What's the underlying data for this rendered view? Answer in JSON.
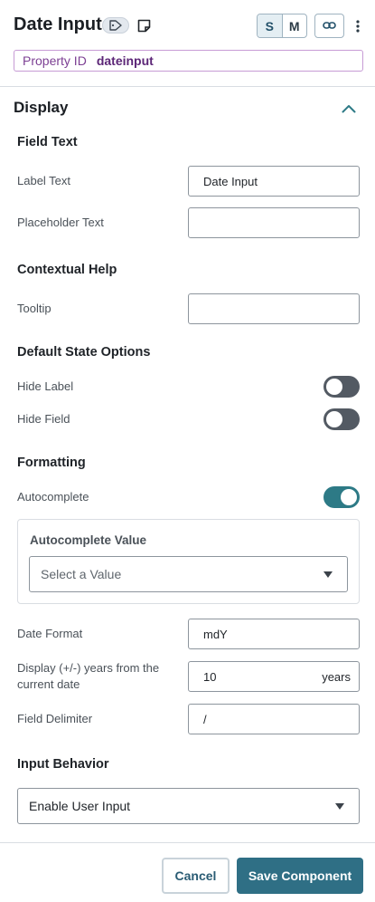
{
  "header": {
    "title": "Date Input",
    "tag_icon": "tag-icon",
    "note_icon": "sticky-note-icon",
    "size_buttons": [
      "S",
      "M"
    ],
    "active_size": "S",
    "link_icon": "link-icon",
    "menu_icon": "kebab-menu-icon",
    "property_id_label": "Property ID",
    "property_id_value": "dateinput"
  },
  "display": {
    "title": "Display",
    "collapse_icon": "chevron-up-icon",
    "field_text": {
      "title": "Field Text",
      "label_text_label": "Label Text",
      "label_text_value": "Date Input",
      "placeholder_text_label": "Placeholder Text",
      "placeholder_text_value": ""
    },
    "contextual_help": {
      "title": "Contextual Help",
      "tooltip_label": "Tooltip",
      "tooltip_value": ""
    },
    "default_state": {
      "title": "Default State Options",
      "hide_label_label": "Hide Label",
      "hide_label_on": false,
      "hide_field_label": "Hide Field",
      "hide_field_on": false
    },
    "formatting": {
      "title": "Formatting",
      "autocomplete_label": "Autocomplete",
      "autocomplete_on": true,
      "autocomplete_value_title": "Autocomplete Value",
      "autocomplete_value_placeholder": "Select a Value",
      "date_format_label": "Date Format",
      "date_format_value": "mdY",
      "years_label": "Display (+/-) years from the current date",
      "years_value": "10",
      "years_suffix": "years",
      "delimiter_label": "Field Delimiter",
      "delimiter_value": "/"
    },
    "input_behavior": {
      "title": "Input Behavior",
      "selected": "Enable User Input"
    }
  },
  "footer": {
    "cancel_label": "Cancel",
    "save_label": "Save Component"
  },
  "colors": {
    "primary": "#2f6f85",
    "toggle_on": "#2d7a86",
    "toggle_off": "#535a63",
    "property_id_border": "#c79bd5"
  }
}
